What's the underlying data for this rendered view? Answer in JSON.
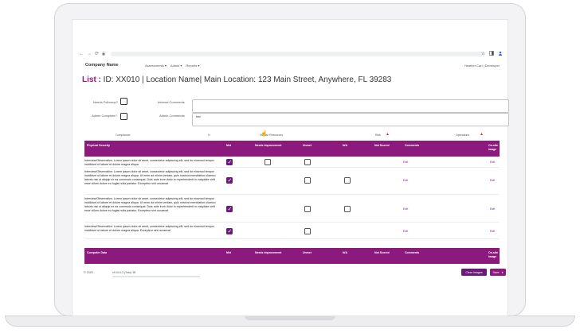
{
  "browser": {
    "back": "←",
    "forward": "→",
    "reload": "⟳",
    "star": "☆"
  },
  "app": {
    "company": "Company Name",
    "menu": [
      "Assessments ▾",
      "Admin ▾",
      "Reports ▾"
    ],
    "user": "Heather Carl | Developer"
  },
  "title": {
    "label": "List :",
    "text": "ID: XX010 | Location Name| Main Location: 123 Main Street, Anywhere, FL  39283"
  },
  "form": {
    "needs_followup": "Needs Followup?",
    "admin_complete": "Admin Complete?",
    "internal_comments": "Internal Comments",
    "admin_comments": "Admin Comments",
    "admin_comments_value": "test"
  },
  "legend": {
    "compliance": "Compliance",
    "h": "H",
    "human_resources": "Human Resources",
    "risk": "Risk",
    "operations": "Operations"
  },
  "physical_security": {
    "columns": [
      "Physical Security",
      "Met",
      "Needs Improvement",
      "Unmet",
      "N/A",
      "Not Scored",
      "Comments",
      "On-site Image"
    ],
    "edit": "Edit",
    "rows": [
      {
        "desc": "Interview/Observation: Lorem ipsum dolor sit amet, consectetur adipiscing elit, sed do eiusmod tempor incididunt ut labore et dolore magna aliqua.",
        "met": true
      },
      {
        "desc": "Interview/Observation: Lorem ipsum dolor sit amet, consectetur adipiscing elit, sed do eiusmod tempor incididunt ut labore et dolore magna aliqua. Ut enim ad minim veniam, quis nostrud exercitation ullamco laboris nisi ut aliquip ex ea commodo consequat. Duis aute irure dolor in reprehenderit in voluptate velit esse cillum dolore eu fugiat nulla pariatur. Excepteur sint occaecat",
        "met": true
      },
      {
        "desc": "Interview/Observation: Lorem ipsum dolor sit amet, consectetur adipiscing elit, sed do eiusmod tempor incididunt ut labore et dolore magna aliqua. Ut enim ad minim veniam, quis nostrud exercitation ullamco laboris nisi ut aliquip ex ea commodo consequat. Duis aute irure dolor in reprehenderit in voluptate velit esse cillum dolore eu fugiat nulla pariatur. Excepteur sint occaecat",
        "met": true
      },
      {
        "desc": "Interview/Observation: Lorem ipsum dolor sit amet, consectetur adipiscing elit, sed do eiusmod tempor incididunt ut labore et dolore magna aliqua. Excepteur sint occaecat",
        "met": true
      }
    ]
  },
  "computer_data": {
    "columns": [
      "Computer Data",
      "Met",
      "Needs Improvement",
      "Unmet",
      "N/A",
      "Not Scored",
      "Comments",
      "On-site Image"
    ]
  },
  "footer": {
    "left": "© 2025 -",
    "version": "v9.04.13 (Test) ·Bi",
    "clear_images": "Clear Images",
    "save": "Save",
    "save_caret": "▾"
  },
  "colors": {
    "accent": "#8c1a7c",
    "accent_dark": "#6a1b7a",
    "warning": "#d32f2f"
  }
}
